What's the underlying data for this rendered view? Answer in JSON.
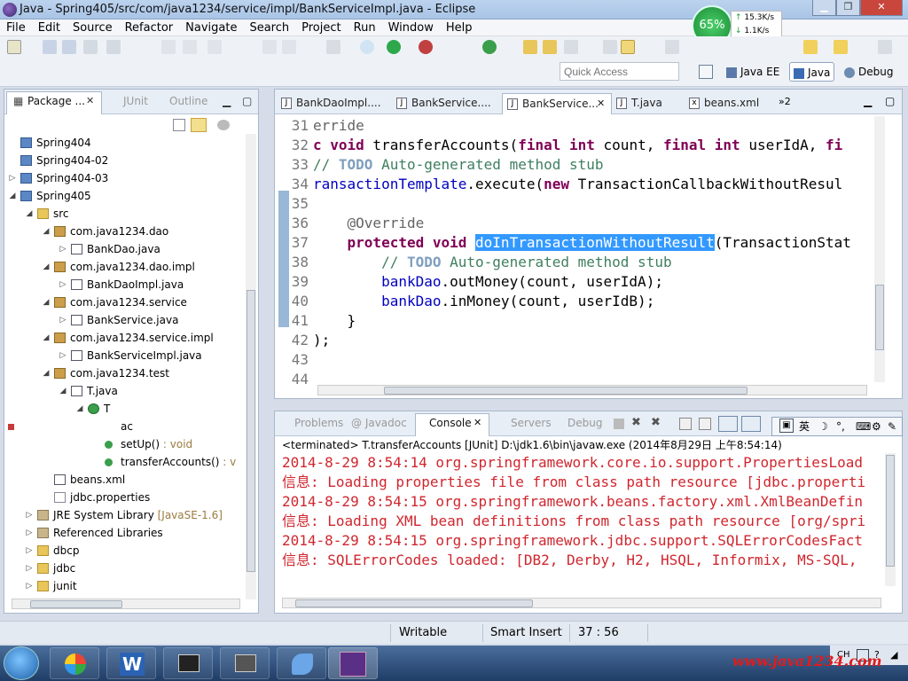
{
  "window": {
    "title": "Java - Spring405/src/com/java1234/service/impl/BankServiceImpl.java - Eclipse"
  },
  "menu": [
    "File",
    "Edit",
    "Source",
    "Refactor",
    "Navigate",
    "Search",
    "Project",
    "Run",
    "Window",
    "Help"
  ],
  "netmeter": {
    "percent": "65%",
    "up": "15.3K/s",
    "down": "1.1K/s"
  },
  "quick_access": {
    "placeholder": "Quick Access"
  },
  "perspectives": {
    "javaee": "Java EE",
    "java": "Java",
    "debug": "Debug"
  },
  "sidebar": {
    "tabs": {
      "package": "Package ...",
      "junit": "JUnit",
      "outline": "Outline"
    },
    "tree": [
      {
        "label": "Spring404",
        "indent": 0,
        "tw": "",
        "icon": "project"
      },
      {
        "label": "Spring404-02",
        "indent": 0,
        "tw": "",
        "icon": "project"
      },
      {
        "label": "Spring404-03",
        "indent": 0,
        "tw": "▷",
        "icon": "project"
      },
      {
        "label": "Spring405",
        "indent": 0,
        "tw": "◢",
        "icon": "project"
      },
      {
        "label": "src",
        "indent": 1,
        "tw": "◢",
        "icon": "folder"
      },
      {
        "label": "com.java1234.dao",
        "indent": 2,
        "tw": "◢",
        "icon": "package"
      },
      {
        "label": "BankDao.java",
        "indent": 3,
        "tw": "▷",
        "icon": "java"
      },
      {
        "label": "com.java1234.dao.impl",
        "indent": 2,
        "tw": "◢",
        "icon": "package"
      },
      {
        "label": "BankDaoImpl.java",
        "indent": 3,
        "tw": "▷",
        "icon": "java"
      },
      {
        "label": "com.java1234.service",
        "indent": 2,
        "tw": "◢",
        "icon": "package"
      },
      {
        "label": "BankService.java",
        "indent": 3,
        "tw": "▷",
        "icon": "java"
      },
      {
        "label": "com.java1234.service.impl",
        "indent": 2,
        "tw": "◢",
        "icon": "package"
      },
      {
        "label": "BankServiceImpl.java",
        "indent": 3,
        "tw": "▷",
        "icon": "java"
      },
      {
        "label": "com.java1234.test",
        "indent": 2,
        "tw": "◢",
        "icon": "package"
      },
      {
        "label": "T.java",
        "indent": 3,
        "tw": "◢",
        "icon": "java"
      },
      {
        "label": "T",
        "indent": 4,
        "tw": "◢",
        "icon": "class"
      },
      {
        "label": "ac",
        "indent": 5,
        "tw": "",
        "icon": "field"
      },
      {
        "label": "setUp()",
        "extra": " : void",
        "indent": 5,
        "tw": "",
        "icon": "method"
      },
      {
        "label": "transferAccounts()",
        "extra": " : v",
        "indent": 5,
        "tw": "",
        "icon": "method"
      },
      {
        "label": "beans.xml",
        "indent": 2,
        "tw": "",
        "icon": "xml"
      },
      {
        "label": "jdbc.properties",
        "indent": 2,
        "tw": "",
        "icon": "file"
      },
      {
        "label": "JRE System Library",
        "extra": " [JavaSE-1.6]",
        "indent": 1,
        "tw": "▷",
        "icon": "lib"
      },
      {
        "label": "Referenced Libraries",
        "indent": 1,
        "tw": "▷",
        "icon": "lib"
      },
      {
        "label": "dbcp",
        "indent": 1,
        "tw": "▷",
        "icon": "folder"
      },
      {
        "label": "jdbc",
        "indent": 1,
        "tw": "▷",
        "icon": "folder"
      },
      {
        "label": "junit",
        "indent": 1,
        "tw": "▷",
        "icon": "folder"
      }
    ]
  },
  "editor": {
    "tabs": [
      {
        "label": "BankDaoImpl....",
        "icon": "J"
      },
      {
        "label": "BankService....",
        "icon": "J"
      },
      {
        "label": "BankService...",
        "icon": "J",
        "active": true
      },
      {
        "label": "T.java",
        "icon": "J"
      },
      {
        "label": "beans.xml",
        "icon": "x"
      }
    ],
    "overflow": "»2",
    "selected_method": "doInTransactionWithoutResult",
    "lines": {
      "n31": "31",
      "n32": "32",
      "n33": "33",
      "n34": "34",
      "n35": "35",
      "n36": "36",
      "n37": "37",
      "n38": "38",
      "n39": "39",
      "n40": "40",
      "n41": "41",
      "n42": "42",
      "n43": "43",
      "n44": "44"
    }
  },
  "console": {
    "tabs": {
      "problems": "Problems",
      "javadoc": "@ Javadoc",
      "console": "Console",
      "servers": "Servers",
      "debug": "Debug"
    },
    "terminated": "<terminated> T.transferAccounts [JUnit] D:\\jdk1.6\\bin\\javaw.exe (2014年8月29日 上午8:54:14)",
    "lines": [
      "2014-8-29 8:54:14 org.springframework.core.io.support.PropertiesLoad",
      "信息: Loading properties file from class path resource [jdbc.properti",
      "2014-8-29 8:54:15 org.springframework.beans.factory.xml.XmlBeanDefin",
      "信息: Loading XML bean definitions from class path resource [org/spri",
      "2014-8-29 8:54:15 org.springframework.jdbc.support.SQLErrorCodesFact",
      "信息: SQLErrorCodes loaded: [DB2, Derby, H2, HSQL, Informix, MS-SQL,"
    ]
  },
  "ime": {
    "lang": "英"
  },
  "status": {
    "writable": "Writable",
    "insert": "Smart Insert",
    "position": "37 : 56"
  },
  "tray": {
    "ch": "CH"
  },
  "watermark": "www.java1234.com",
  "colors": {
    "keyword": "#7f0055",
    "comment": "#3f7f5f",
    "console_error": "#d0262e",
    "selection": "#3399ff"
  }
}
